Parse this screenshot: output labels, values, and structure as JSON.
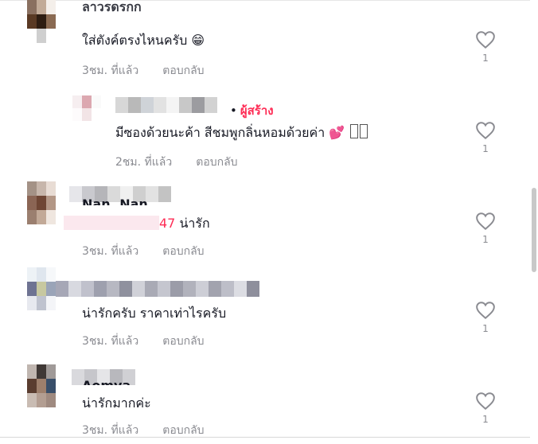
{
  "comments": [
    {
      "username": "ลาวรดรกก",
      "text": "ใส่ตังค์ตรงไหนครับ",
      "emoji": "😁",
      "time": "3ชม. ที่แล้ว",
      "reply": "ตอบกลับ",
      "likes": "1"
    },
    {
      "creator_label": "ผู้สร้าง",
      "text": "มีซองด้วยนะค้า สีชมพูกลิ่นหอมด้วยค่า",
      "emoji": "💕",
      "time": "2ชม. ที่แล้ว",
      "reply": "ตอบกลับ",
      "likes": "1"
    },
    {
      "username": "Nan. Nan",
      "mention": "47",
      "text": "น่ารัก",
      "time": "3ชม. ที่แล้ว",
      "reply": "ตอบกลับ",
      "likes": "1"
    },
    {
      "text": "น่ารักครับ ราคาเท่าไรครับ",
      "time": "3ชม. ที่แล้ว",
      "reply": "ตอบกลับ",
      "likes": "1"
    },
    {
      "username": "Aomya",
      "text": "น่ารักมากค่ะ",
      "time": "3ชม. ที่แล้ว",
      "reply": "ตอบกลับ",
      "likes": "1"
    }
  ],
  "icons": {
    "like": "heart-outline-icon"
  },
  "colors": {
    "accent": "#fe2c55",
    "muted": "#8a8b91",
    "text": "#161823"
  }
}
